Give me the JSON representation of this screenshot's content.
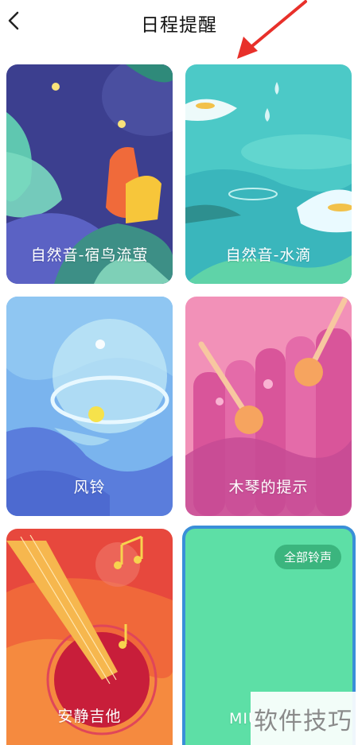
{
  "header": {
    "title": "日程提醒"
  },
  "cards": [
    {
      "label": "自然音-宿鸟流萤"
    },
    {
      "label": "自然音-水滴"
    },
    {
      "label": "风铃"
    },
    {
      "label": "木琴的提示"
    },
    {
      "label": "安静吉他"
    },
    {
      "label": "MIU",
      "all_button": "全部铃声"
    }
  ],
  "watermark": "软件技巧",
  "colors": {
    "accent_red": "#e8302a",
    "selected_border": "#3a8fd8",
    "mint": "#5ddfa6"
  }
}
